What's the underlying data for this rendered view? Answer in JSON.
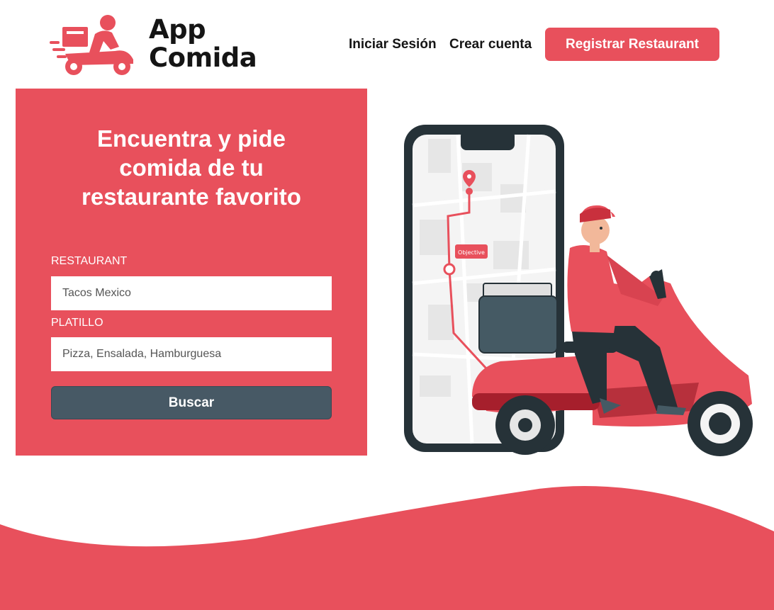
{
  "brand": {
    "line1": "App",
    "line2": "Comida",
    "color": "#e8505c",
    "icon": "delivery-scooter-icon"
  },
  "nav": {
    "login": "Iniciar Sesión",
    "signup": "Crear cuenta",
    "register": "Registrar Restaurant"
  },
  "search": {
    "headline": "Encuentra y pide comida de tu restaurante favorito",
    "restaurant_label": "RESTAURANT",
    "restaurant_placeholder": "Tacos Mexico",
    "dish_label": "PLATILLO",
    "dish_placeholder": "Pizza, Ensalada, Hamburguesa",
    "button": "Buscar",
    "button_color": "#475965"
  },
  "illustration": {
    "map_tag": "Objective",
    "icon": "delivery-rider-illustration"
  }
}
